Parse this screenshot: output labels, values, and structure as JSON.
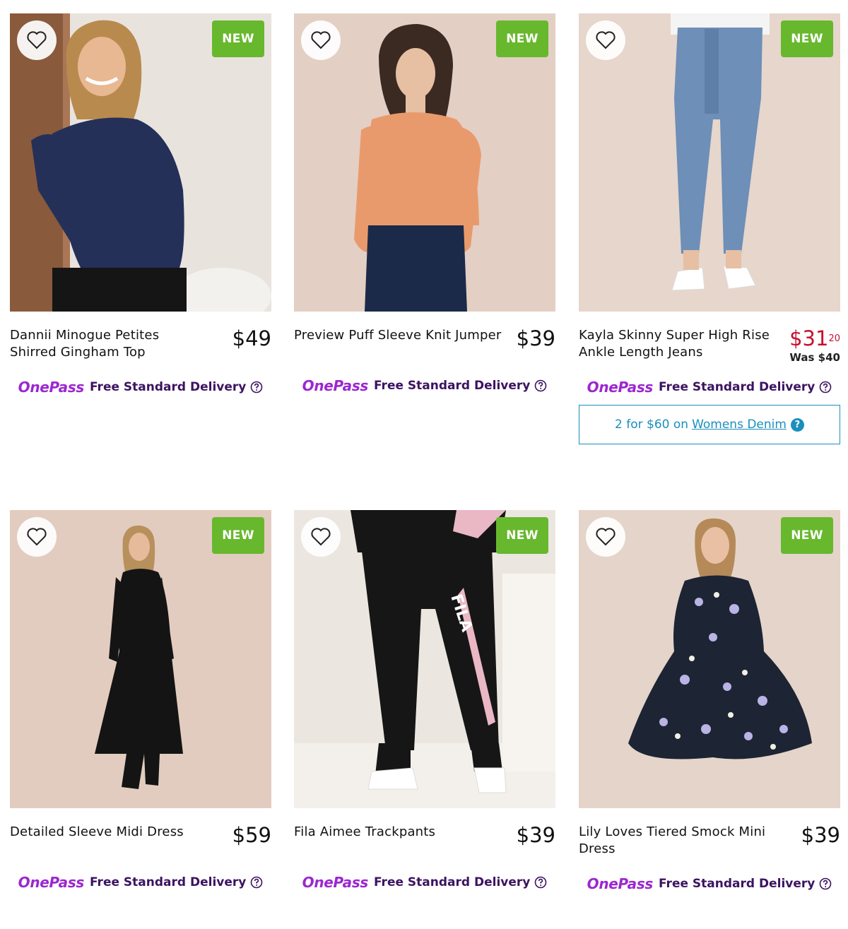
{
  "badge_label": "NEW",
  "delivery": {
    "brand": "OnePass",
    "text": "Free Standard Delivery"
  },
  "colors": {
    "new_badge": "#68b82e",
    "sale_price": "#c8102e",
    "onepass": "#9c27d0",
    "promo_border": "#1a8fbd"
  },
  "products": [
    {
      "title": "Dannii Minogue Petites Shirred Gingham Top",
      "price": "$49",
      "image": "woman-in-navy-gingham-top"
    },
    {
      "title": "Preview Puff Sleeve Knit Jumper",
      "price": "$39",
      "image": "woman-in-orange-knit-jumper"
    },
    {
      "title": "Kayla Skinny Super High Rise Ankle Length Jeans",
      "price_dollars": "$31",
      "price_cents": "20",
      "was": "Was $40",
      "image": "legs-in-light-blue-skinny-jeans",
      "promo": {
        "prefix": "2 for $60 on",
        "link": "Womens Denim",
        "help": "?"
      }
    },
    {
      "title": "Detailed Sleeve Midi Dress",
      "price": "$59",
      "image": "woman-in-black-midi-dress"
    },
    {
      "title": "Fila Aimee Trackpants",
      "price": "$39",
      "image": "black-fila-trackpants-with-pink-stripe",
      "logo_text": "FILA"
    },
    {
      "title": "Lily Loves Tiered Smock Mini Dress",
      "price": "$39",
      "image": "woman-in-floral-smock-mini-dress"
    }
  ]
}
